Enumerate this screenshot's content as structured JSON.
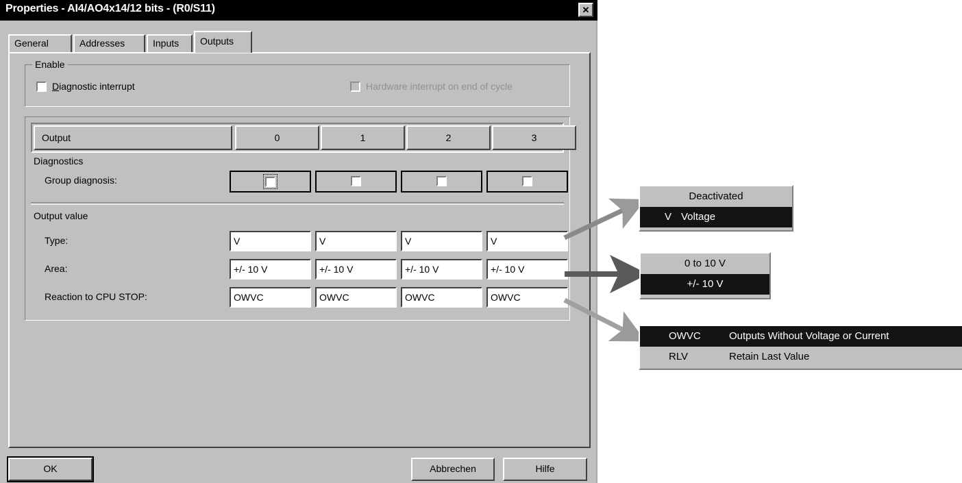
{
  "window": {
    "title": "Properties - AI4/AO4x14/12 bits - (R0/S11)",
    "close_label": "✕"
  },
  "tabs": [
    {
      "label": "General",
      "active": false
    },
    {
      "label": "Addresses",
      "active": false
    },
    {
      "label": "Inputs",
      "active": false
    },
    {
      "label": "Outputs",
      "active": true
    }
  ],
  "enable_group": {
    "legend": "Enable",
    "diagnostic_interrupt": {
      "label_first": "D",
      "label_rest": "iagnostic interrupt",
      "checked": false,
      "enabled": true
    },
    "hardware_interrupt": {
      "label_first": "H",
      "label_rest": "ardware interrupt on end of cycle",
      "checked": false,
      "enabled": false
    }
  },
  "output_table": {
    "header_label": "Output",
    "columns": [
      "0",
      "1",
      "2",
      "3"
    ],
    "diagnostics_section": "Diagnostics",
    "group_diagnosis_label": "Group diagnosis:",
    "group_diagnosis_values": [
      false,
      false,
      false,
      false
    ],
    "output_value_section": "Output value",
    "rows": [
      {
        "label": "Type:",
        "values": [
          "V",
          "V",
          "V",
          "V"
        ]
      },
      {
        "label": "Area:",
        "values": [
          "+/- 10 V",
          "+/- 10 V",
          "+/- 10 V",
          "+/- 10 V"
        ]
      },
      {
        "label": "Reaction to CPU STOP:",
        "values": [
          "OWVC",
          "OWVC",
          "OWVC",
          "OWVC"
        ]
      }
    ]
  },
  "buttons": {
    "ok": "OK",
    "cancel": "Abbrechen",
    "help": "Hilfe"
  },
  "callouts": {
    "type": {
      "options": [
        {
          "code": "",
          "text": "Deactivated",
          "selected": false
        },
        {
          "code": "V",
          "text": "Voltage",
          "selected": true
        }
      ]
    },
    "area": {
      "options": [
        {
          "code": "",
          "text": "0 to 10 V",
          "selected": false
        },
        {
          "code": "",
          "text": "+/- 10 V",
          "selected": true
        }
      ]
    },
    "reaction": {
      "options": [
        {
          "code": "OWVC",
          "text": "Outputs Without Voltage or Current",
          "selected": true
        },
        {
          "code": "RLV",
          "text": "Retain Last Value",
          "selected": false
        }
      ]
    }
  },
  "colors": {
    "dialog_face": "#c0c0c0",
    "titlebar": "#000000",
    "field_bg": "#ffffff",
    "selection_bg": "#141414",
    "arrow_dark": "#5a5a5a",
    "arrow_light": "#9a9a9a"
  }
}
